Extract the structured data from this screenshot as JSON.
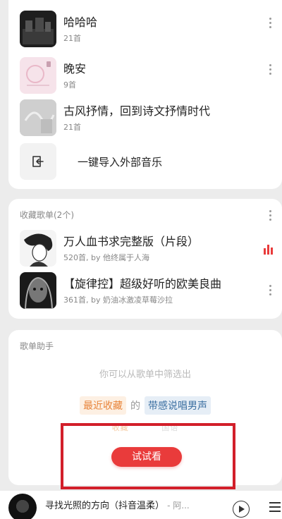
{
  "created_playlists": [
    {
      "title": "哈哈哈",
      "count": "21首"
    },
    {
      "title": "晚安",
      "count": "9首"
    },
    {
      "title": "古风抒情，回到诗文抒情时代",
      "count": "21首"
    }
  ],
  "import": {
    "label": "一键导入外部音乐"
  },
  "collected": {
    "header": "收藏歌单(2个)",
    "items": [
      {
        "title": "万人血书求完整版（片段）",
        "meta": "520首, by 他终属于人海"
      },
      {
        "title": "【旋律控】超级好听的欧美良曲",
        "meta": "361首, by 奶油冰激凌草莓沙拉"
      }
    ]
  },
  "helper": {
    "header": "歌单助手",
    "hint": "你可以从歌单中筛选出",
    "chip1": "最近收藏",
    "connector": "的",
    "chip2": "带感说唱男声",
    "faded_a": "收藏",
    "faded_b": "国语",
    "button": "试试看"
  },
  "player": {
    "title": "寻找光照的方向（抖音温柔）",
    "artist": "- 阿..."
  },
  "colors": {
    "accent": "#e93b3b",
    "highlight_box": "#d21f2a"
  }
}
